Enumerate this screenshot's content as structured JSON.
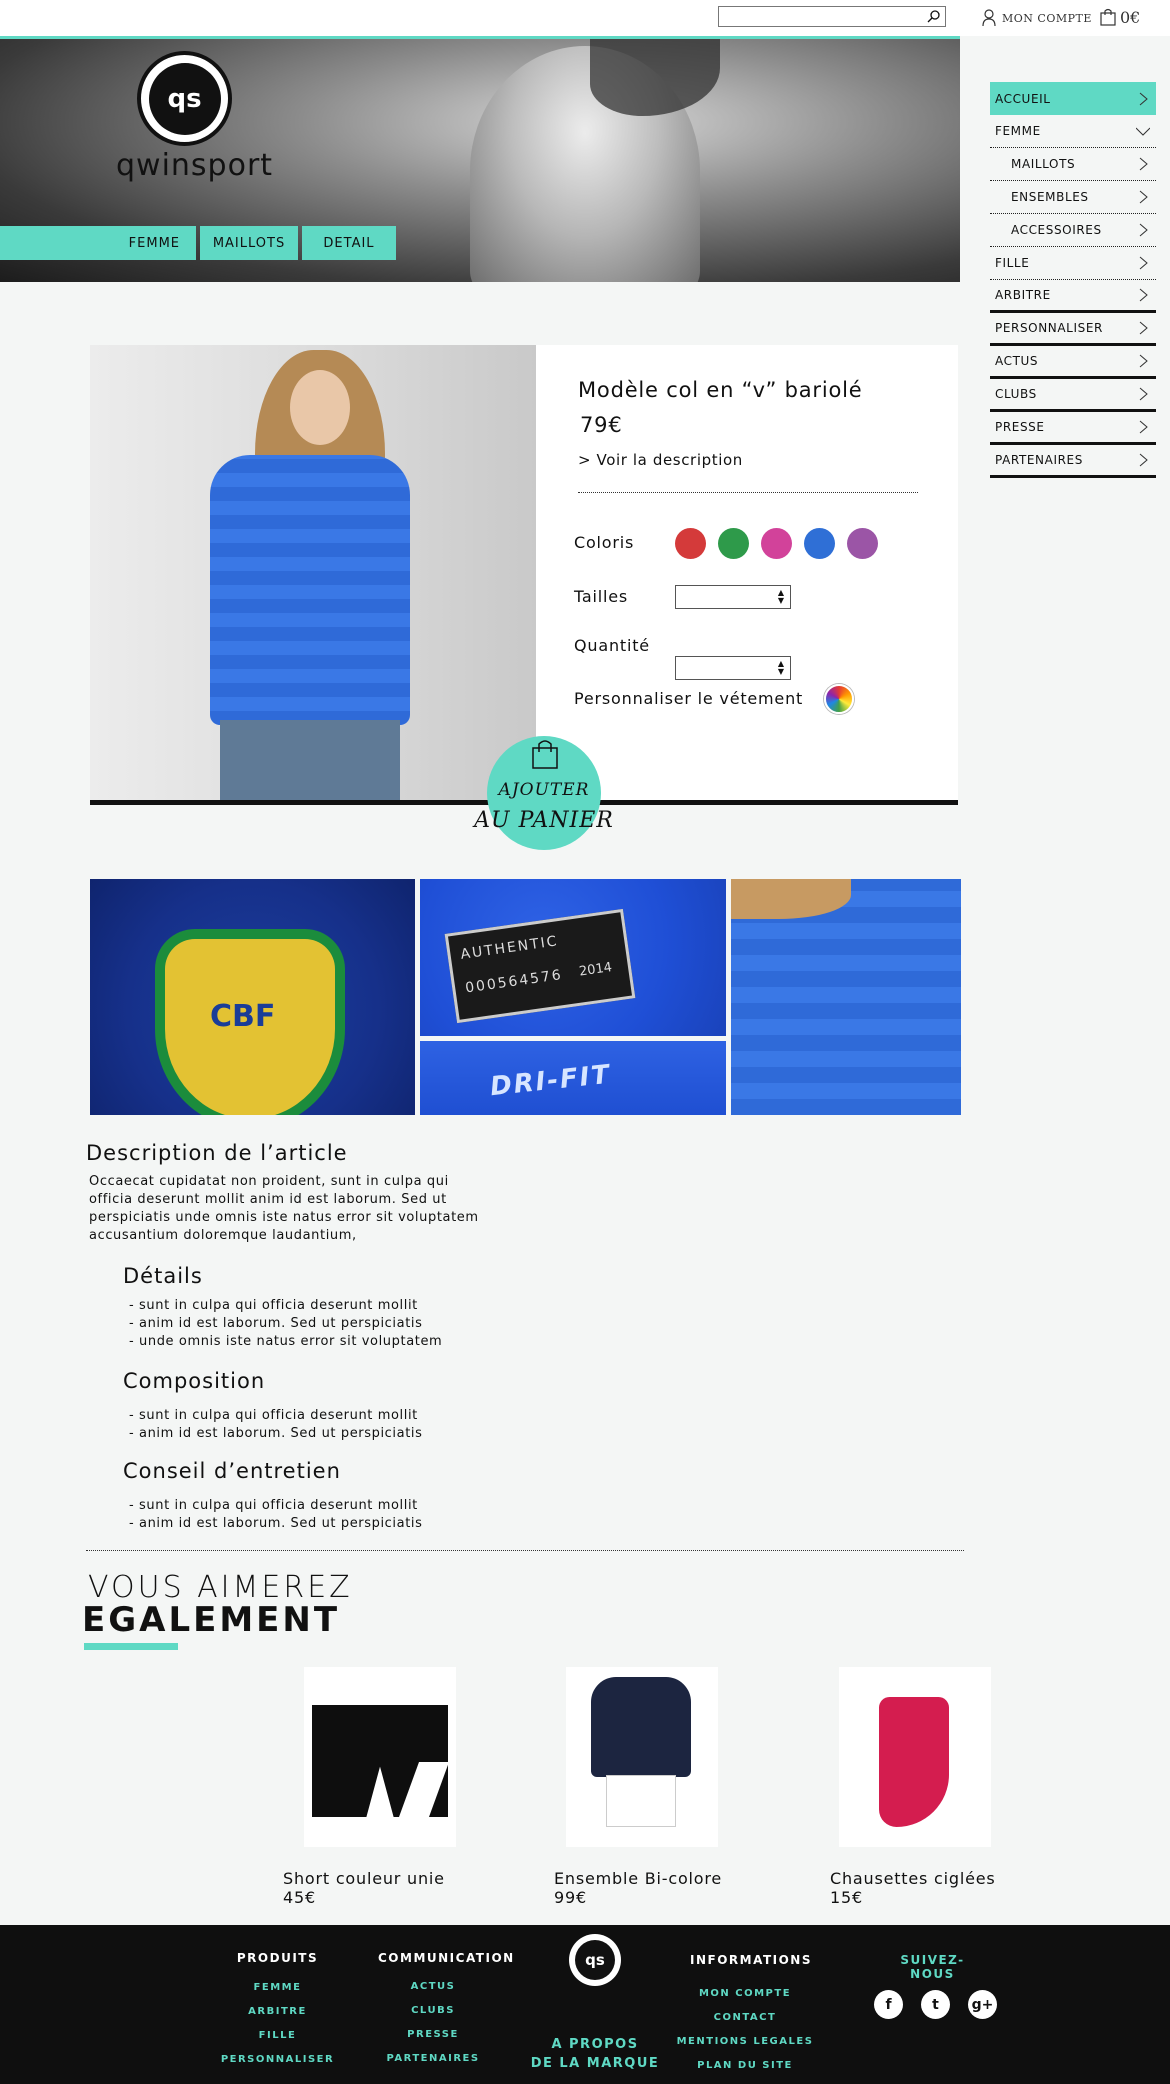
{
  "header": {
    "search": {
      "value": "",
      "placeholder": ""
    },
    "account_label": "MON COMPTE",
    "cart_amount": "0€"
  },
  "brand": {
    "logo_text": "qs",
    "name": "qwinsport"
  },
  "breadcrumb": [
    "FEMME",
    "MAILLOTS",
    "DETAIL"
  ],
  "sidebar": {
    "items": [
      {
        "label": "ACCUEIL",
        "active": true
      },
      {
        "label": "FEMME",
        "expanded": true
      },
      {
        "label": "MAILLOTS"
      },
      {
        "label": "ENSEMBLES"
      },
      {
        "label": "ACCESSOIRES"
      },
      {
        "label": "FILLE"
      },
      {
        "label": "ARBITRE"
      },
      {
        "label": "PERSONNALISER"
      },
      {
        "label": "ACTUS"
      },
      {
        "label": "CLUBS"
      },
      {
        "label": "PRESSE"
      },
      {
        "label": "PARTENAIRES"
      }
    ]
  },
  "product": {
    "title": "Modèle col en “v” bariolé",
    "price": "79€",
    "description_link": "> Voir la description",
    "coloris_label": "Coloris",
    "colors": [
      "#d43a3a",
      "#2e9a4a",
      "#d2429a",
      "#2f6fd6",
      "#9b55a6"
    ],
    "tailles_label": "Tailles",
    "tailles_value": "",
    "quantite_label": "Quantité",
    "quantite_value": "",
    "personnaliser_label": "Personnaliser le vétement",
    "add_to_cart_line1": "AJOUTER",
    "add_to_cart_line2": "AU PANIER"
  },
  "gallery": {
    "authentic_label": "AUTHENTIC",
    "authentic_number": "000564576",
    "authentic_year": "2014",
    "crest_text": "CBF",
    "drifit_text": "DRI-FIT"
  },
  "description": {
    "title": "Description de l’article",
    "body": "Occaecat cupidatat non proident, sunt in culpa qui officia deserunt mollit anim id est laborum. Sed ut perspiciatis unde omnis iste natus error sit voluptatem accusantium doloremque laudantium,",
    "details_title": "Détails",
    "details": [
      "sunt in culpa qui officia deserunt mollit",
      "anim id est laborum. Sed ut perspiciatis",
      "unde omnis iste natus error sit voluptatem"
    ],
    "composition_title": "Composition",
    "composition": [
      "sunt in culpa qui officia deserunt mollit",
      "anim id est laborum. Sed ut perspiciatis"
    ],
    "conseil_title": "Conseil d’entretien",
    "conseil": [
      "sunt in culpa qui officia deserunt mollit",
      "anim id est laborum. Sed ut perspiciatis"
    ]
  },
  "recommendations": {
    "title_line1": "VOUS AIMEREZ",
    "title_line2": "EGALEMENT",
    "items": [
      {
        "name": "Short couleur unie",
        "price": "45€"
      },
      {
        "name": "Ensemble Bi-colore",
        "price": "99€"
      },
      {
        "name": "Chausettes ciglées",
        "price": "15€"
      }
    ]
  },
  "footer": {
    "produits_title": "PRODUITS",
    "produits": [
      "FEMME",
      "ARBITRE",
      "FILLE",
      "PERSONNALISER"
    ],
    "communication_title": "COMMUNICATION",
    "communication": [
      "ACTUS",
      "CLUBS",
      "PRESSE",
      "PARTENAIRES"
    ],
    "logo_text": "qs",
    "apropos_line1": "A PROPOS",
    "apropos_line2": "DE LA MARQUE",
    "informations_title": "INFORMATIONS",
    "informations": [
      "MON COMPTE",
      "CONTACT",
      "MENTIONS LEGALES",
      "PLAN DU SITE"
    ],
    "suivez_label": "SUIVEZ-NOUS",
    "social": [
      "f",
      "t",
      "g+"
    ]
  },
  "colors": {
    "accent": "#5fd9c4",
    "dark": "#0f0f0f"
  }
}
